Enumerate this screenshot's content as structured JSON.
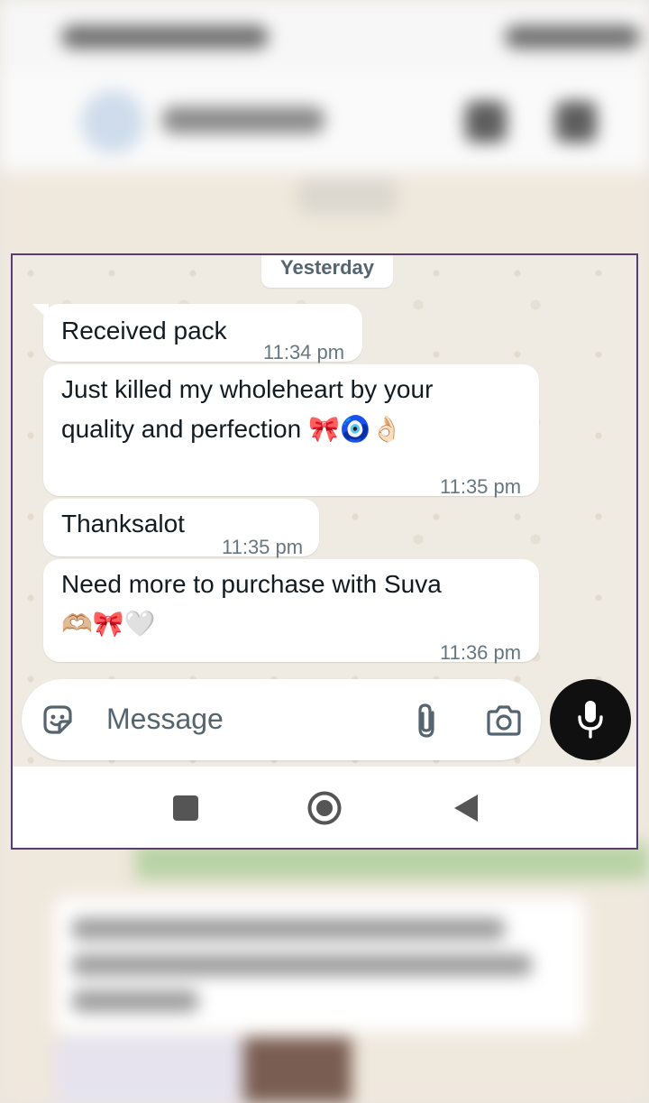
{
  "chat": {
    "date_divider": "Yesterday",
    "messages": [
      {
        "lines": [
          "Received pack"
        ],
        "time": "11:34 pm"
      },
      {
        "lines": [
          "Just killed my wholeheart by your",
          "quality and perfection 🎀🧿👌🏻"
        ],
        "time": "11:35 pm"
      },
      {
        "lines": [
          "Thanksalot"
        ],
        "time": "11:35 pm"
      },
      {
        "lines": [
          "Need more to purchase with Suva",
          "🫶🏼🎀🤍"
        ],
        "time": "11:36 pm"
      }
    ]
  },
  "composer": {
    "placeholder": "Message",
    "icons": {
      "emoji": "sticker-icon",
      "attach": "paperclip-icon",
      "camera": "camera-icon",
      "voice": "microphone-icon"
    }
  },
  "navbar": {
    "icons": [
      "recents-square-icon",
      "home-circle-icon",
      "back-triangle-icon"
    ]
  },
  "colors": {
    "chat_bg": "#efeae2",
    "bubble": "#ffffff",
    "mic_button": "#101010",
    "frame_border": "#5b3a7a"
  }
}
